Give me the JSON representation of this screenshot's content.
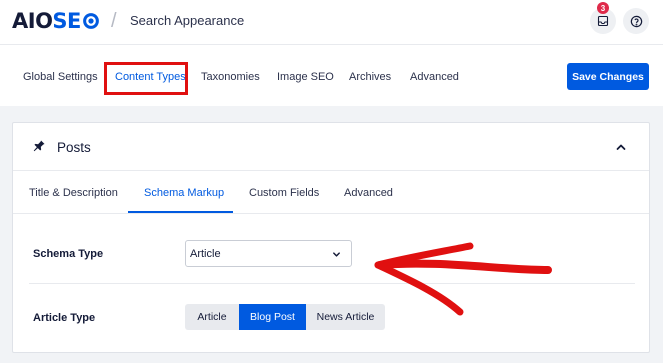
{
  "header": {
    "logo_aio": "AIO",
    "logo_seo": "SE",
    "logo_gear": "gear-icon",
    "separator": "/",
    "page_title": "Search Appearance",
    "notification_count": "3",
    "notification_icon": "inbox-icon",
    "help_icon": "help-icon"
  },
  "nav": {
    "items": [
      {
        "label": "Global Settings"
      },
      {
        "label": "Content Types"
      },
      {
        "label": "Taxonomies"
      },
      {
        "label": "Image SEO"
      },
      {
        "label": "Archives"
      },
      {
        "label": "Advanced"
      }
    ],
    "active_index": 1,
    "save_label": "Save Changes"
  },
  "card": {
    "icon": "pin-icon",
    "title": "Posts",
    "collapse_icon": "chevron-up-icon",
    "tabs": [
      {
        "label": "Title & Description"
      },
      {
        "label": "Schema Markup"
      },
      {
        "label": "Custom Fields"
      },
      {
        "label": "Advanced"
      }
    ],
    "active_tab": 1,
    "schema_type": {
      "label": "Schema Type",
      "value": "Article",
      "chevron_icon": "chevron-down-icon"
    },
    "article_type": {
      "label": "Article Type",
      "options": [
        "Article",
        "Blog Post",
        "News Article"
      ],
      "selected": "Blog Post"
    }
  },
  "colors": {
    "accent": "#005ae0",
    "highlight": "#e01010",
    "badge": "#df2a4a",
    "text": "#141b38",
    "page_bg": "#f1f3f6"
  }
}
